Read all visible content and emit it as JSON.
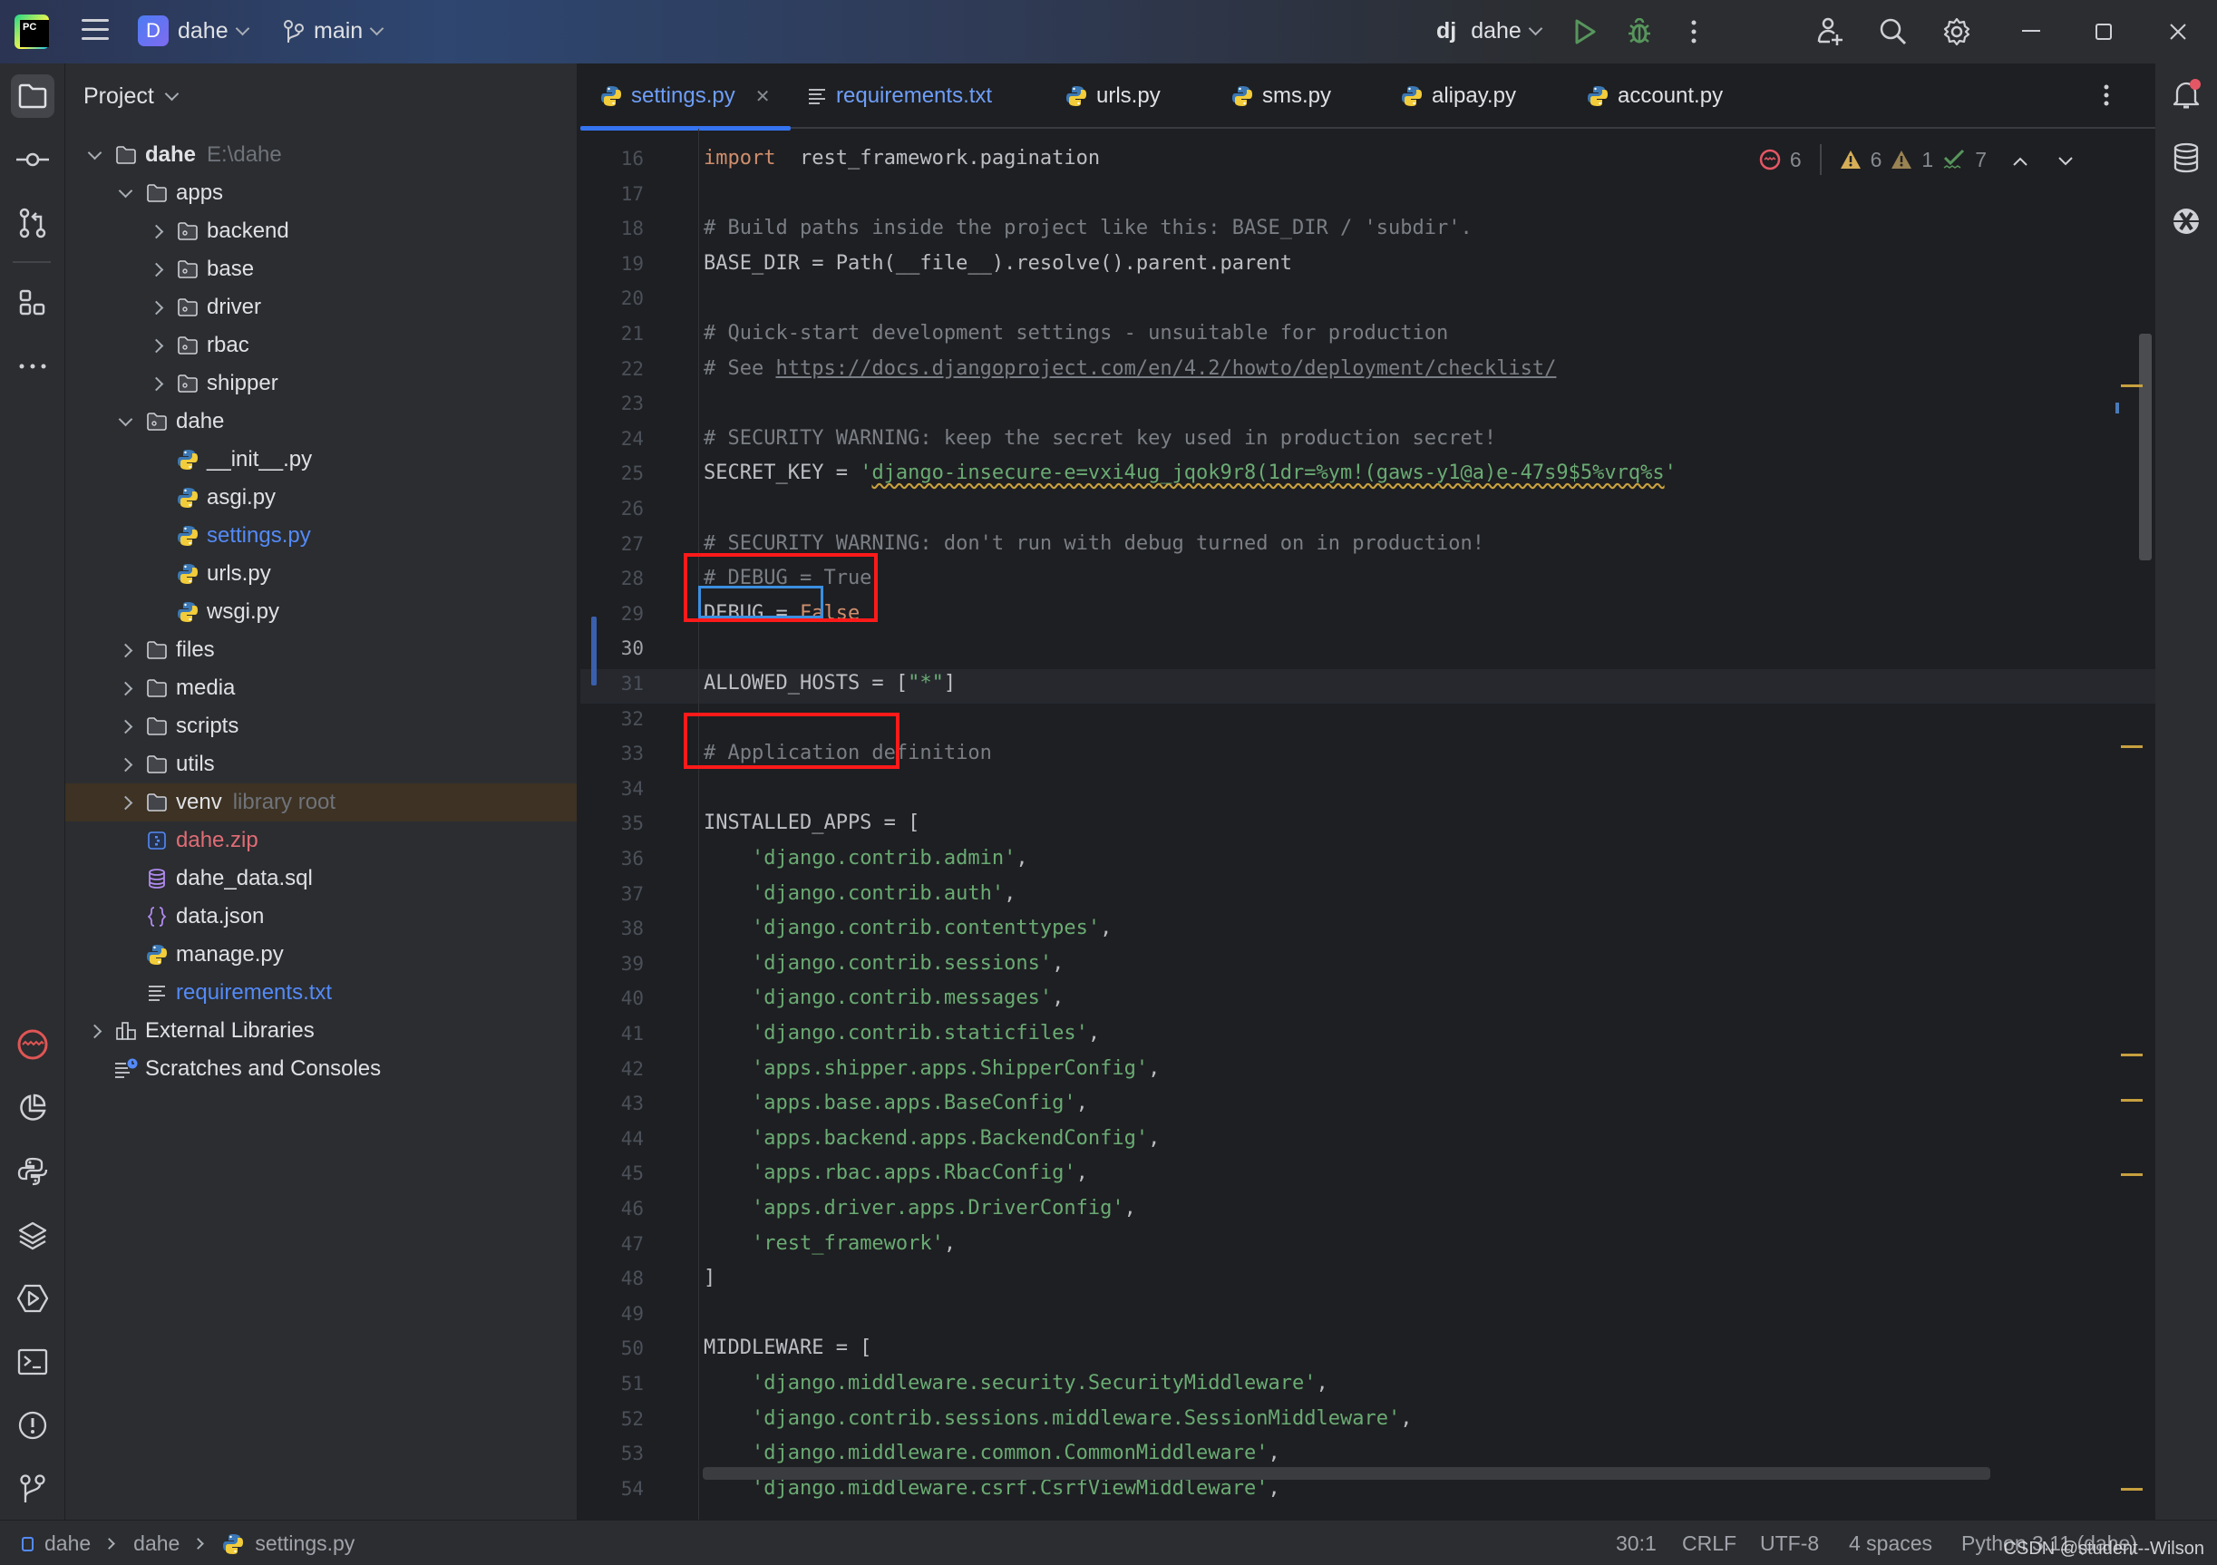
{
  "titlebar": {
    "project_initial": "D",
    "project_name": "dahe",
    "branch": "main",
    "run_config_prefix": "dj",
    "run_config": "dahe",
    "icons": [
      "pycharm-logo",
      "hamburger-menu-icon",
      "branch-icon",
      "run-icon",
      "debug-icon",
      "more-icon",
      "add-user-icon",
      "search-icon",
      "settings-gear-icon",
      "minimize-icon",
      "maximize-icon",
      "close-icon"
    ]
  },
  "left_toolbar": {
    "top": [
      "project-folder-icon",
      "commit-icon",
      "pull-requests-icon",
      "structure-icon",
      "more-tools-icon"
    ],
    "bottom": [
      "profiler-icon",
      "coverage-icon",
      "python-console-icon",
      "services-layers-icon",
      "run-services-icon",
      "terminal-icon",
      "problems-icon",
      "git-icon"
    ]
  },
  "project_panel": {
    "title": "Project",
    "tree": [
      {
        "label": "dahe",
        "hint": "E:\\dahe",
        "arrow": "down",
        "icon": "folder",
        "depth": 0,
        "bold": true
      },
      {
        "label": "apps",
        "arrow": "down",
        "icon": "folder",
        "depth": 1
      },
      {
        "label": "backend",
        "arrow": "right",
        "icon": "package",
        "depth": 2
      },
      {
        "label": "base",
        "arrow": "right",
        "icon": "package",
        "depth": 2
      },
      {
        "label": "driver",
        "arrow": "right",
        "icon": "package",
        "depth": 2
      },
      {
        "label": "rbac",
        "arrow": "right",
        "icon": "package",
        "depth": 2
      },
      {
        "label": "shipper",
        "arrow": "right",
        "icon": "package",
        "depth": 2
      },
      {
        "label": "dahe",
        "arrow": "down",
        "icon": "package",
        "depth": 1
      },
      {
        "label": "__init__.py",
        "arrow": "none",
        "icon": "python",
        "depth": 2
      },
      {
        "label": "asgi.py",
        "arrow": "none",
        "icon": "python",
        "depth": 2
      },
      {
        "label": "settings.py",
        "arrow": "none",
        "icon": "python",
        "depth": 2,
        "color": "blue"
      },
      {
        "label": "urls.py",
        "arrow": "none",
        "icon": "python",
        "depth": 2
      },
      {
        "label": "wsgi.py",
        "arrow": "none",
        "icon": "python",
        "depth": 2
      },
      {
        "label": "files",
        "arrow": "right",
        "icon": "folder",
        "depth": 1
      },
      {
        "label": "media",
        "arrow": "right",
        "icon": "folder",
        "depth": 1
      },
      {
        "label": "scripts",
        "arrow": "right",
        "icon": "folder",
        "depth": 1
      },
      {
        "label": "utils",
        "arrow": "right",
        "icon": "folder",
        "depth": 1
      },
      {
        "label": "venv",
        "hint": "library root",
        "arrow": "right",
        "icon": "folder",
        "depth": 1,
        "highlight": true
      },
      {
        "label": "dahe.zip",
        "arrow": "none",
        "icon": "zip",
        "depth": 1,
        "color": "red"
      },
      {
        "label": "dahe_data.sql",
        "arrow": "none",
        "icon": "database",
        "depth": 1
      },
      {
        "label": "data.json",
        "arrow": "none",
        "icon": "json",
        "depth": 1
      },
      {
        "label": "manage.py",
        "arrow": "none",
        "icon": "python",
        "depth": 1
      },
      {
        "label": "requirements.txt",
        "arrow": "none",
        "icon": "text",
        "depth": 1,
        "color": "blue"
      },
      {
        "label": "External Libraries",
        "arrow": "right",
        "icon": "libraries",
        "depth": 0
      },
      {
        "label": "Scratches and Consoles",
        "arrow": "none",
        "icon": "scratches",
        "depth": 0
      }
    ]
  },
  "tabs": [
    {
      "label": "settings.py",
      "icon": "python",
      "active": true,
      "closable": true
    },
    {
      "label": "requirements.txt",
      "icon": "text",
      "color": "blue"
    },
    {
      "label": "urls.py",
      "icon": "python"
    },
    {
      "label": "sms.py",
      "icon": "python"
    },
    {
      "label": "alipay.py",
      "icon": "python"
    },
    {
      "label": "account.py",
      "icon": "python"
    }
  ],
  "inspections": {
    "errors": "6",
    "warnings": "6",
    "weak_warnings": "1",
    "typos": "7"
  },
  "editor": {
    "current_line": 30,
    "lines": [
      {
        "n": "16",
        "segs": [
          [
            "kw",
            "import"
          ],
          [
            "",
            "  rest_framework.pagination"
          ]
        ]
      },
      {
        "n": "17",
        "segs": []
      },
      {
        "n": "18",
        "segs": [
          [
            "cm",
            "# Build paths inside the project like this: BASE_DIR / 'subdir'."
          ]
        ]
      },
      {
        "n": "19",
        "segs": [
          [
            "",
            "BASE_DIR = Path(__file__).resolve().parent.parent"
          ]
        ]
      },
      {
        "n": "20",
        "segs": []
      },
      {
        "n": "21",
        "segs": [
          [
            "cm",
            "# Quick-start development settings - unsuitable for production"
          ]
        ]
      },
      {
        "n": "22",
        "segs": [
          [
            "cm",
            "# See "
          ],
          [
            "lnk",
            "https://docs.djangoproject.com/en/4.2/howto/deployment/checklist/"
          ]
        ]
      },
      {
        "n": "23",
        "segs": []
      },
      {
        "n": "24",
        "segs": [
          [
            "cm",
            "# SECURITY WARNING: keep the secret key used in production secret!"
          ]
        ]
      },
      {
        "n": "25",
        "segs": [
          [
            "",
            "SECRET_KEY = "
          ],
          [
            "st",
            "'"
          ],
          [
            "st warnsq",
            "django-insecure-e=vxi4ug_jqok9r8(1dr=%ym!(gaws-y1@a)e-47s9$5%vrq%s"
          ],
          [
            "st",
            "'"
          ]
        ]
      },
      {
        "n": "26",
        "segs": []
      },
      {
        "n": "27",
        "segs": [
          [
            "cm",
            "# SECURITY WARNING: don't run with debug turned on in production!"
          ]
        ]
      },
      {
        "n": "28",
        "segs": [
          [
            "cm",
            "# DEBUG = True"
          ]
        ]
      },
      {
        "n": "29",
        "segs": [
          [
            "",
            "DEBUG = "
          ],
          [
            "kw",
            "False"
          ]
        ]
      },
      {
        "n": "30",
        "segs": []
      },
      {
        "n": "31",
        "segs": [
          [
            "",
            "ALLOWED_HOSTS = ["
          ],
          [
            "st",
            "\"*\""
          ],
          [
            "",
            "]"
          ]
        ]
      },
      {
        "n": "32",
        "segs": []
      },
      {
        "n": "33",
        "segs": [
          [
            "cm",
            "# Application definition"
          ]
        ]
      },
      {
        "n": "34",
        "segs": []
      },
      {
        "n": "35",
        "segs": [
          [
            "",
            "INSTALLED_APPS = ["
          ]
        ]
      },
      {
        "n": "36",
        "segs": [
          [
            "",
            "    "
          ],
          [
            "st",
            "'django.contrib.admin'"
          ],
          [
            "",
            ","
          ]
        ]
      },
      {
        "n": "37",
        "segs": [
          [
            "",
            "    "
          ],
          [
            "st",
            "'django.contrib.auth'"
          ],
          [
            "",
            ","
          ]
        ]
      },
      {
        "n": "38",
        "segs": [
          [
            "",
            "    "
          ],
          [
            "st",
            "'django.contrib.contenttypes'"
          ],
          [
            "",
            ","
          ]
        ]
      },
      {
        "n": "39",
        "segs": [
          [
            "",
            "    "
          ],
          [
            "st",
            "'django.contrib.sessions'"
          ],
          [
            "",
            ","
          ]
        ]
      },
      {
        "n": "40",
        "segs": [
          [
            "",
            "    "
          ],
          [
            "st",
            "'django.contrib.messages'"
          ],
          [
            "",
            ","
          ]
        ]
      },
      {
        "n": "41",
        "segs": [
          [
            "",
            "    "
          ],
          [
            "st",
            "'django.contrib.staticfiles'"
          ],
          [
            "",
            ","
          ]
        ]
      },
      {
        "n": "42",
        "segs": [
          [
            "",
            "    "
          ],
          [
            "st",
            "'apps.shipper.apps.ShipperConfig'"
          ],
          [
            "",
            ","
          ]
        ]
      },
      {
        "n": "43",
        "segs": [
          [
            "",
            "    "
          ],
          [
            "st",
            "'apps.base.apps.BaseConfig'"
          ],
          [
            "",
            ","
          ]
        ]
      },
      {
        "n": "44",
        "segs": [
          [
            "",
            "    "
          ],
          [
            "st",
            "'apps.backend.apps.BackendConfig'"
          ],
          [
            "",
            ","
          ]
        ]
      },
      {
        "n": "45",
        "segs": [
          [
            "",
            "    "
          ],
          [
            "st",
            "'apps.rbac.apps.RbacConfig'"
          ],
          [
            "",
            ","
          ]
        ]
      },
      {
        "n": "46",
        "segs": [
          [
            "",
            "    "
          ],
          [
            "st",
            "'apps.driver.apps.DriverConfig'"
          ],
          [
            "",
            ","
          ]
        ]
      },
      {
        "n": "47",
        "segs": [
          [
            "",
            "    "
          ],
          [
            "st",
            "'rest_framework'"
          ],
          [
            "",
            ","
          ]
        ]
      },
      {
        "n": "48",
        "segs": [
          [
            "",
            "]"
          ]
        ]
      },
      {
        "n": "49",
        "segs": []
      },
      {
        "n": "50",
        "segs": [
          [
            "",
            "MIDDLEWARE = ["
          ]
        ]
      },
      {
        "n": "51",
        "segs": [
          [
            "",
            "    "
          ],
          [
            "st",
            "'django.middleware.security.SecurityMiddleware'"
          ],
          [
            "",
            ","
          ]
        ]
      },
      {
        "n": "52",
        "segs": [
          [
            "",
            "    "
          ],
          [
            "st",
            "'django.contrib.sessions.middleware.SessionMiddleware'"
          ],
          [
            "",
            ","
          ]
        ]
      },
      {
        "n": "53",
        "segs": [
          [
            "",
            "    "
          ],
          [
            "st",
            "'django.middleware.common.CommonMiddleware'"
          ],
          [
            "",
            ","
          ]
        ]
      },
      {
        "n": "54",
        "segs": [
          [
            "",
            "    "
          ],
          [
            "st",
            "'django.middleware.csrf.CsrfViewMiddleware'"
          ],
          [
            "",
            ","
          ]
        ]
      }
    ]
  },
  "right_toolbar": [
    "notifications-icon",
    "database-icon",
    "sciview-icon"
  ],
  "statusbar": {
    "breadcrumb": [
      "dahe",
      "dahe",
      "settings.py"
    ],
    "position": "30:1",
    "line_separator": "CRLF",
    "encoding": "UTF-8",
    "indent": "4 spaces",
    "interpreter": "Python 3.11 (dahe)",
    "watermark": "CSDN @student--Wilson"
  },
  "colors": {
    "accent": "#3574f0",
    "keyword": "#cf8e6d",
    "string": "#6aab73",
    "comment": "#7a7e85",
    "annotation_box": "#ff1a1a",
    "selection_box": "#3b8fe0"
  }
}
